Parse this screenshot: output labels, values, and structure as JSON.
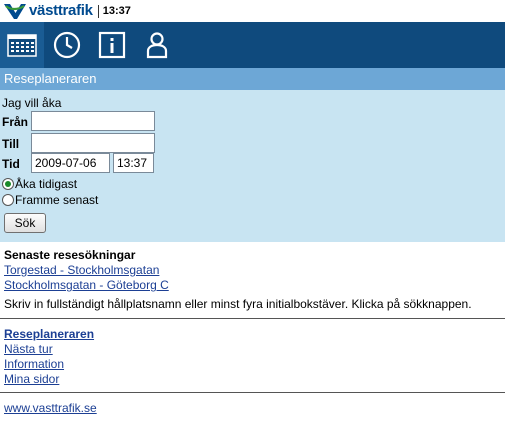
{
  "header": {
    "logo_text": "västtrafik",
    "time": "13:37"
  },
  "nav": {
    "items": [
      {
        "name": "calendar-icon",
        "active": true
      },
      {
        "name": "clock-icon",
        "active": false
      },
      {
        "name": "info-icon",
        "active": false
      },
      {
        "name": "person-icon",
        "active": false
      }
    ]
  },
  "page_title": "Reseplaneraren",
  "form": {
    "intro": "Jag vill åka",
    "from_label": "Från",
    "from_value": "",
    "to_label": "Till",
    "to_value": "",
    "time_label": "Tid",
    "date_value": "2009-07-06",
    "time_value": "13:37",
    "radio_depart": "Åka tidigast",
    "radio_arrive": "Framme senast",
    "selected_radio": "depart",
    "search_button": "Sök"
  },
  "recent": {
    "title": "Senaste resesökningar",
    "items": [
      "Torgestad - Stockholmsgatan",
      "Stockholmsgatan - Göteborg C"
    ]
  },
  "info_text": "Skriv in fullständigt hållplatsnamn eller minst fyra initialbokstäver. Klicka på sökknappen.",
  "menu": {
    "items": [
      "Reseplaneraren",
      "Nästa tur",
      "Information",
      "Mina sidor"
    ]
  },
  "footer": {
    "link": "www.vasttrafik.se"
  },
  "colors": {
    "nav_bg": "#0f4a7d",
    "title_bg": "#6da7d6",
    "form_bg": "#c8e4f2",
    "link": "#1c3f94"
  }
}
